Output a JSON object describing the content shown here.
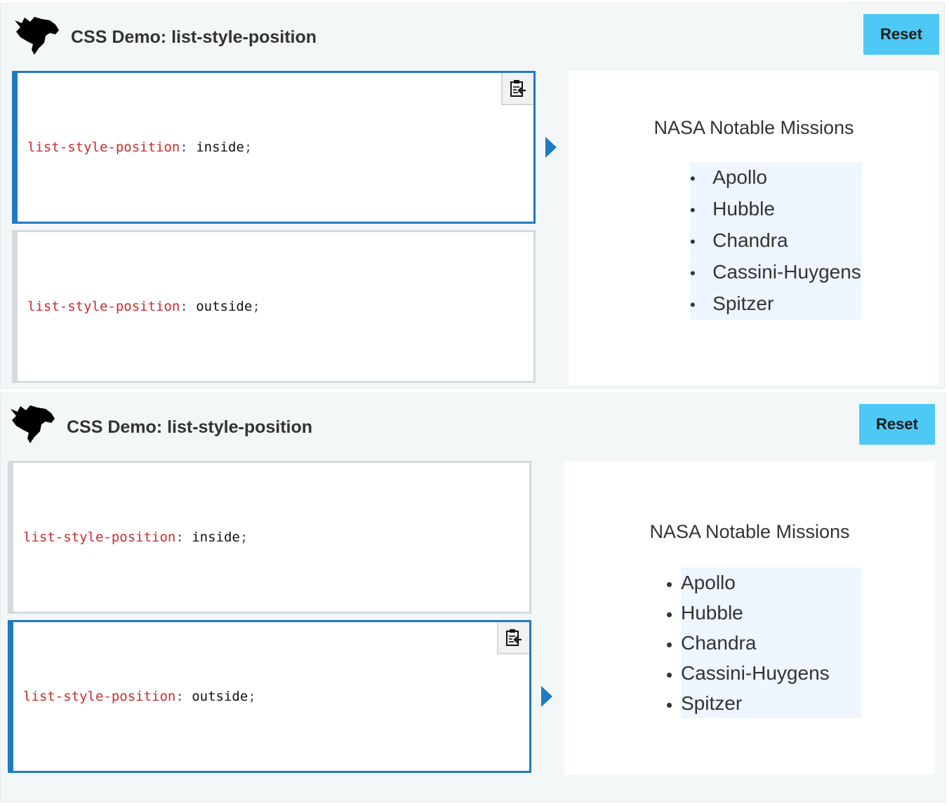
{
  "demos": [
    {
      "title": "CSS Demo: list-style-position",
      "reset_label": "Reset",
      "choices": [
        {
          "property": "list-style-position",
          "value": "inside",
          "selected": true
        },
        {
          "property": "list-style-position",
          "value": "outside",
          "selected": false
        }
      ],
      "output": {
        "heading": "NASA Notable Missions",
        "items": [
          "Apollo",
          "Hubble",
          "Chandra",
          "Cassini-Huygens",
          "Spitzer"
        ]
      }
    },
    {
      "title": "CSS Demo: list-style-position",
      "reset_label": "Reset",
      "choices": [
        {
          "property": "list-style-position",
          "value": "inside",
          "selected": false
        },
        {
          "property": "list-style-position",
          "value": "outside",
          "selected": true
        }
      ],
      "output": {
        "heading": "NASA Notable Missions",
        "items": [
          "Apollo",
          "Hubble",
          "Chandra",
          "Cassini-Huygens",
          "Spitzer"
        ]
      }
    }
  ],
  "colors": {
    "accent": "#1f7bc0",
    "reset_bg": "#4ec9f5",
    "property": "#c72e2e",
    "list_bg": "#eef6ff",
    "panel_bg": "#f4f7f8"
  },
  "icons": [
    "dino-logo-icon",
    "copy-to-clipboard-icon",
    "play-arrow-icon"
  ]
}
